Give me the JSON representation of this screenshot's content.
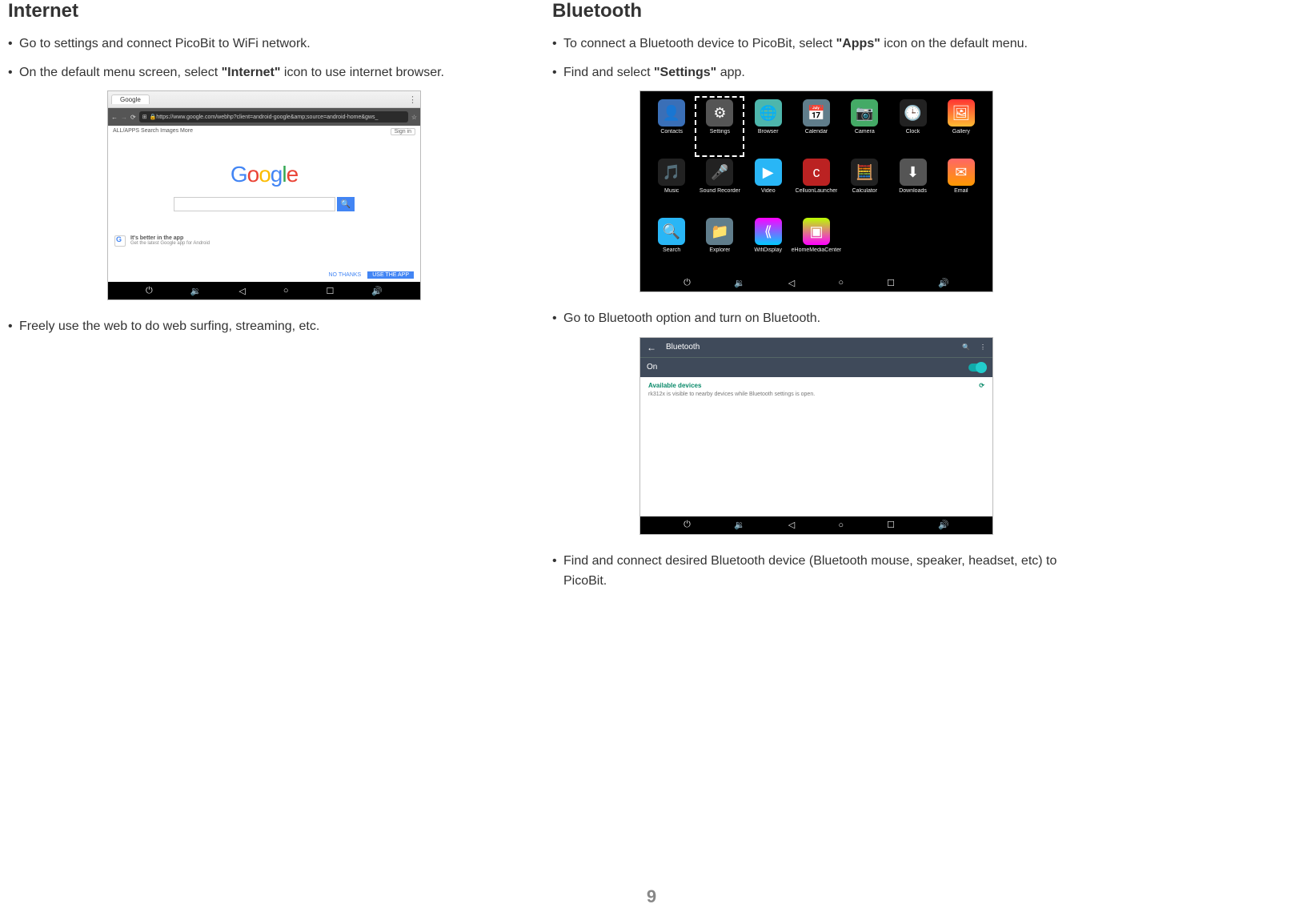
{
  "page_number": "9",
  "left": {
    "heading": "Internet",
    "b1": "Go to settings and connect PicoBit to WiFi network.",
    "b2_pre": "On the default menu screen, select ",
    "b2_bold": "\"Internet\"",
    "b2_post": " icon to use internet browser.",
    "b3": "Freely use the web to do web surfing, streaming, etc.",
    "browser": {
      "tab": "Google",
      "url": "https://www.google.com/webhp?client=android-google&amp;source=android-home&gws_",
      "nav_left": "ALL/APPS   Search   Images   More ",
      "nav_right": "Sign in",
      "search_button_glyph": "🔍",
      "promo_title": "It's better in the app",
      "promo_sub": "Get the latest Google app for Android",
      "no_thanks": "NO THANKS",
      "use_app": "USE THE APP"
    }
  },
  "right": {
    "heading": "Bluetooth",
    "b1_pre": "To connect a Bluetooth device to PicoBit, select ",
    "b1_bold": "\"Apps\"",
    "b1_post": " icon on the default menu.",
    "b2_pre": "Find and select ",
    "b2_bold": "\"Settings\"",
    "b2_post": " app.",
    "b3": "Go to Bluetooth option and turn on Bluetooth.",
    "b4": "Find and connect desired Bluetooth device (Bluetooth mouse, speaker, headset, etc) to PicoBit.",
    "apps": [
      {
        "label": "Contacts",
        "cls": "i-contacts",
        "glyph": "👤"
      },
      {
        "label": "Settings",
        "cls": "i-settings",
        "glyph": "⚙",
        "hl": true
      },
      {
        "label": "Browser",
        "cls": "i-browser",
        "glyph": "🌐"
      },
      {
        "label": "Calendar",
        "cls": "i-calendar",
        "glyph": "📅"
      },
      {
        "label": "Camera",
        "cls": "i-camera",
        "glyph": "📷"
      },
      {
        "label": "Clock",
        "cls": "i-clock",
        "glyph": "🕒"
      },
      {
        "label": "Gallery",
        "cls": "i-gallery",
        "glyph": "🖼"
      },
      {
        "label": "Music",
        "cls": "i-music",
        "glyph": "🎵"
      },
      {
        "label": "Sound Recorder",
        "cls": "i-sound",
        "glyph": "🎤"
      },
      {
        "label": "Video",
        "cls": "i-video",
        "glyph": "▶"
      },
      {
        "label": "CelluonLauncher",
        "cls": "i-celluon",
        "glyph": "c"
      },
      {
        "label": "Calculator",
        "cls": "i-calc",
        "glyph": "🧮"
      },
      {
        "label": "Downloads",
        "cls": "i-down",
        "glyph": "⬇"
      },
      {
        "label": "Email",
        "cls": "i-email",
        "glyph": "✉"
      },
      {
        "label": "Search",
        "cls": "i-search",
        "glyph": "🔍"
      },
      {
        "label": "Explorer",
        "cls": "i-explorer",
        "glyph": "📁"
      },
      {
        "label": "WifiDisplay",
        "cls": "i-wifi",
        "glyph": "⟪"
      },
      {
        "label": "eHomeMediaCenter",
        "cls": "i-ehome",
        "glyph": "▣"
      }
    ],
    "bt": {
      "title": "Bluetooth",
      "state": "On",
      "available": "Available devices",
      "refresh_glyph": "⟳",
      "note": "rk312x is visible to nearby devices while Bluetooth settings is open.",
      "search_glyph": "🔍",
      "more_glyph": "⋮",
      "back_glyph": "←"
    }
  },
  "navbar": {
    "power": "⏻",
    "vol_down": "🔉",
    "back": "◁",
    "home": "○",
    "recents": "☐",
    "vol_up": "🔊"
  }
}
